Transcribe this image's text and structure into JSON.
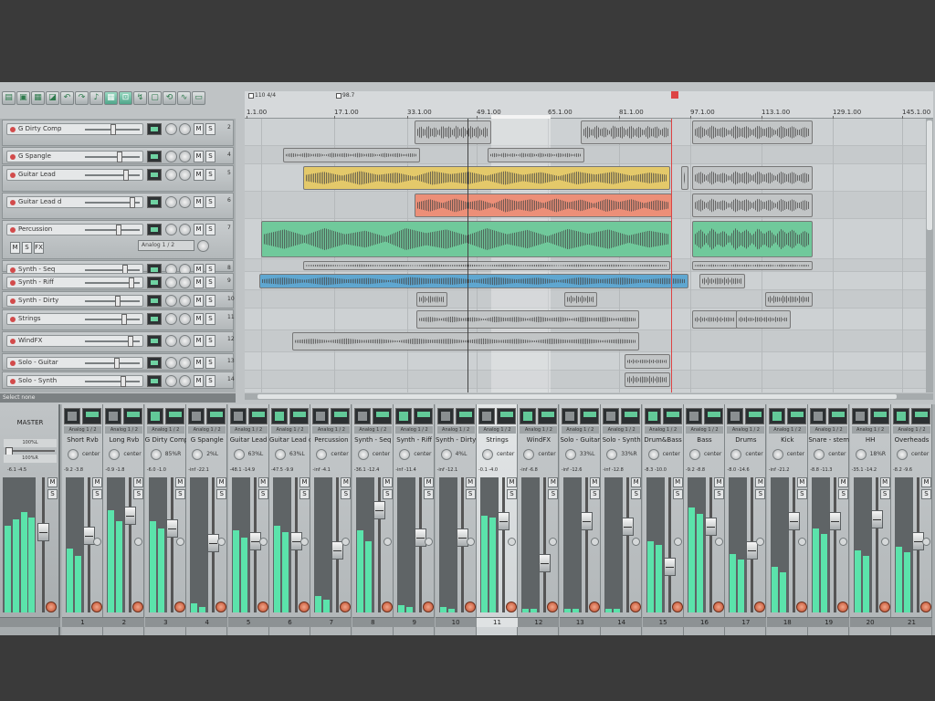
{
  "toolbar": {
    "icons": [
      "new-project-icon",
      "open-icon",
      "save-icon",
      "project-settings-icon",
      "undo-icon",
      "redo-icon",
      "metronome-icon",
      "grid-icon",
      "snap-icon",
      "ripple-icon",
      "lock-icon",
      "loop-icon",
      "envelope-icon",
      "folder-icon"
    ]
  },
  "ruler": {
    "markers": [
      {
        "label": "110 4/4"
      },
      {
        "label": "98.7"
      }
    ],
    "ticks": [
      "1.1.00",
      "17.1.00",
      "33.1.00",
      "49.1.00",
      "65.1.00",
      "81.1.00",
      "97.1.00",
      "113.1.00",
      "129.1.00",
      "145.1.00"
    ]
  },
  "tracks": [
    {
      "name": "G Dirty Comp",
      "num": "2"
    },
    {
      "name": "G Spangle",
      "num": "4"
    },
    {
      "name": "Guitar Lead",
      "num": "5"
    },
    {
      "name": "Guitar Lead d",
      "num": "6"
    },
    {
      "name": "Percussion",
      "num": "7"
    },
    {
      "name": "Synth - Seq",
      "num": "8"
    },
    {
      "name": "Synth - Riff",
      "num": "9"
    },
    {
      "name": "Synth - Dirty",
      "num": "10"
    },
    {
      "name": "Strings",
      "num": "11"
    },
    {
      "name": "WindFX",
      "num": "12"
    },
    {
      "name": "Solo - Guitar",
      "num": "13"
    },
    {
      "name": "Solo - Synth",
      "num": "14"
    }
  ],
  "percussion_extra": {
    "env_label": "Analog 1 / 2"
  },
  "status": {
    "text": "Select none"
  },
  "items_colors": {
    "gray": "#c2c5c6",
    "yellow": "#e4c96a",
    "red": "#ec8f78",
    "green": "#70c99b",
    "blue": "#5fa7d1"
  },
  "mixer": {
    "master": {
      "label": "MASTER",
      "lines": [
        "100%L",
        "100%R"
      ],
      "peaks": "-6.1 -4.5"
    },
    "strips": [
      {
        "name": "Short Rvb",
        "num": "1",
        "pan": "center",
        "route": "Analog 1 / 2"
      },
      {
        "name": "Long Rvb",
        "num": "2",
        "pan": "center",
        "route": "Analog 1 / 2"
      },
      {
        "name": "G Dirty Comp",
        "num": "3",
        "pan": "85%R",
        "route": "Analog 1 / 2"
      },
      {
        "name": "G Spangle",
        "num": "4",
        "pan": "2%L",
        "route": "Analog 1 / 2"
      },
      {
        "name": "Guitar Lead",
        "num": "5",
        "pan": "63%L",
        "route": "Analog 1 / 2"
      },
      {
        "name": "Guitar Lead d",
        "num": "6",
        "pan": "63%L",
        "route": "Analog 1 / 2"
      },
      {
        "name": "Percussion",
        "num": "7",
        "pan": "center",
        "route": "Analog 1 / 2"
      },
      {
        "name": "Synth - Seq",
        "num": "8",
        "pan": "center",
        "route": "Analog 1 / 2"
      },
      {
        "name": "Synth - Riff",
        "num": "9",
        "pan": "center",
        "route": "Analog 1 / 2"
      },
      {
        "name": "Synth - Dirty",
        "num": "10",
        "pan": "4%L",
        "route": "Analog 1 / 2"
      },
      {
        "name": "Strings",
        "num": "11",
        "pan": "center",
        "route": "Analog 1 / 2"
      },
      {
        "name": "WindFX",
        "num": "12",
        "pan": "center",
        "route": "Analog 1 / 2"
      },
      {
        "name": "Solo - Guitar",
        "num": "13",
        "pan": "33%L",
        "route": "Analog 1 / 2"
      },
      {
        "name": "Solo - Synth",
        "num": "14",
        "pan": "33%R",
        "route": "Analog 1 / 2"
      },
      {
        "name": "Drum&Bass",
        "num": "15",
        "pan": "center",
        "route": "Analog 1 / 2"
      },
      {
        "name": "Bass",
        "num": "16",
        "pan": "center",
        "route": "Analog 1 / 2"
      },
      {
        "name": "Drums",
        "num": "17",
        "pan": "center",
        "route": "Analog 1 / 2"
      },
      {
        "name": "Kick",
        "num": "18",
        "pan": "center",
        "route": "Analog 1 / 2"
      },
      {
        "name": "Snare - stem",
        "num": "19",
        "pan": "center",
        "route": "Analog 1 / 2"
      },
      {
        "name": "HH",
        "num": "20",
        "pan": "18%R",
        "route": "Analog 1 / 2"
      },
      {
        "name": "Overheads",
        "num": "21",
        "pan": "center",
        "route": "Analog 1 / 2"
      }
    ]
  }
}
